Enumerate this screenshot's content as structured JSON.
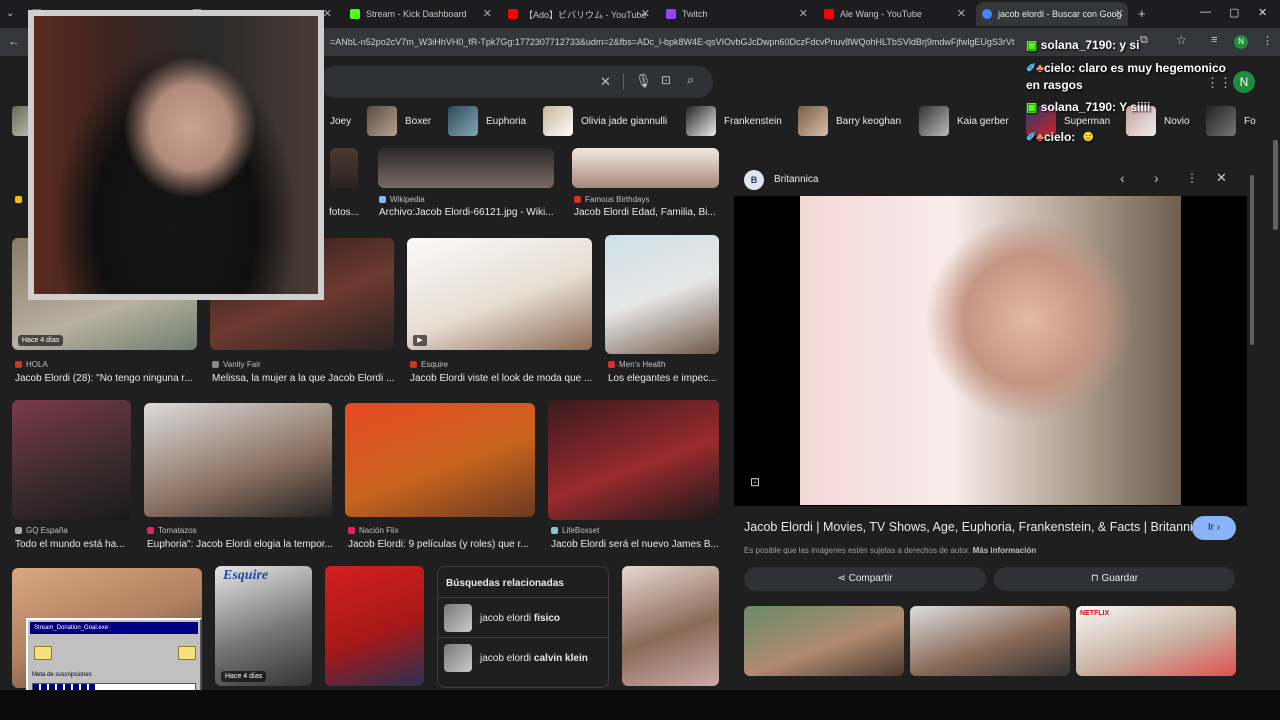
{
  "tabs": [
    {
      "label": "",
      "color": "#1aa260"
    },
    {
      "label": "",
      "color": "#e37400"
    },
    {
      "label": "Stream - Kick Dashboard",
      "color": "#53fc18"
    },
    {
      "label": "【Ado】ビバリウム - YouTube",
      "color": "#ff0000"
    },
    {
      "label": "Twitch",
      "color": "#9146ff"
    },
    {
      "label": "Ale Wang - YouTube",
      "color": "#ff0000"
    },
    {
      "label": "jacob elordi - Buscar con Goog",
      "color": "#4285f4"
    }
  ],
  "url": "=ANbL-n52po2cV7m_W3iHhVH0_fR-Tpk7Gg:1772307712733&udm=2&fbs=ADc_l-bpk8W4E-qsVIOvbGJcDwpn60DczFdcvPnuv8WQohHLTbSVldBrj9mdwFjfwlgEUgS3rVt",
  "profile_initial": "N",
  "chips": [
    "Joey",
    "Boxer",
    "Euphoria",
    "Olivia jade giannulli",
    "Frankenstein",
    "Barry keoghan",
    "Kaia gerber",
    "Superman",
    "Novio",
    "Fo"
  ],
  "results": [
    {
      "source": "Wikipedia",
      "caption": "Archivo:Jacob Elordi-66121.jpg - Wiki...",
      "color": "#8ab4f8"
    },
    {
      "source": "Famous Birthdays",
      "caption": "Jacob Elordi Edad, Familia, Bi...",
      "color": "#d93025"
    },
    {
      "source": "HOLA",
      "caption": "Jacob Elordi (28): \"No tengo ninguna r...",
      "color": "#d93025",
      "badge": "Hace 4 días"
    },
    {
      "source": "Vanity Fair",
      "caption": "Melissa, la mujer a la que Jacob Elordi ...",
      "color": "#888888"
    },
    {
      "source": "Esquire",
      "caption": "Jacob Elordi viste el look de moda que ...",
      "color": "#d93025"
    },
    {
      "source": "Men's Health",
      "caption": "Los elegantes e impec...",
      "color": "#d93025"
    },
    {
      "source": "GQ España",
      "caption": "Todo el mundo está ha...",
      "color": "#aaaaaa"
    },
    {
      "source": "Tomatazos",
      "caption": "Euphoria\": Jacob Elordi elogia la tempor...",
      "color": "#e91e63"
    },
    {
      "source": "Nación Flix",
      "caption": "Jacob Elordi: 9 películas (y roles) que r...",
      "color": "#e91e63"
    },
    {
      "source": "LifeBoxset",
      "caption": "Jacob Elordi será el nuevo James B...",
      "color": "#80cbc4"
    }
  ],
  "partial_caption": "fotos...",
  "bottom_badge": "Hace 4 días",
  "related": {
    "title": "Búsquedas relacionadas",
    "items": [
      {
        "prefix": "jacob elordi ",
        "bold": "fisico"
      },
      {
        "prefix": "jacob elordi ",
        "bold": "calvin klein"
      }
    ]
  },
  "panel": {
    "source": "Britannica",
    "title": "Jacob Elordi | Movies, TV Shows, Age, Euphoria, Frankenstein, & Facts | Britannica",
    "visit": "Ir",
    "notice": "Es posible que las imágenes estén sujetas a derechos de autor.",
    "more_info": "Más información",
    "share": "Compartir",
    "save": "Guardar",
    "netflix": "NETFLIX"
  },
  "chat": [
    {
      "user": "solana_7190:",
      "msg": " y si"
    },
    {
      "user": "cielo:",
      "msg": " claro es muy hegemonico"
    },
    {
      "user": "",
      "msg": "en rasgos"
    },
    {
      "user": "solana_7190:",
      "msg": " Y siiii"
    },
    {
      "user": "cielo:",
      "msg": ""
    }
  ],
  "donation": {
    "title": "Stream_Donation_Goal.exe",
    "label": "Meta de suscripciones",
    "progress": 0.38
  }
}
